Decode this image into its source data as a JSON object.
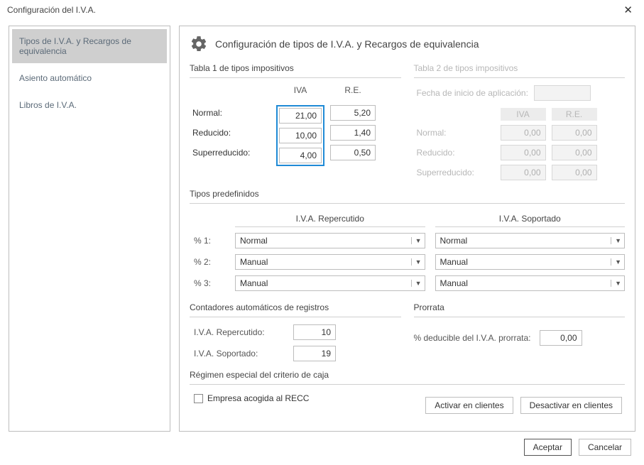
{
  "window": {
    "title": "Configuración del I.V.A."
  },
  "sidebar": {
    "items": [
      {
        "label": "Tipos de I.V.A. y Recargos de equivalencia"
      },
      {
        "label": "Asiento automático"
      },
      {
        "label": "Libros de I.V.A."
      }
    ]
  },
  "header": {
    "title": "Configuración de tipos de I.V.A. y Recargos de equivalencia"
  },
  "table1": {
    "title": "Tabla 1 de tipos impositivos",
    "col_iva": "IVA",
    "col_re": "R.E.",
    "rows": {
      "normal_label": "Normal:",
      "normal_iva": "21,00",
      "normal_re": "5,20",
      "reducido_label": "Reducido:",
      "reducido_iva": "10,00",
      "reducido_re": "1,40",
      "super_label": "Superreducido:",
      "super_iva": "4,00",
      "super_re": "0,50"
    }
  },
  "table2": {
    "title": "Tabla 2 de tipos impositivos",
    "fecha_label": "Fecha de inicio de aplicación:",
    "col_iva": "IVA",
    "col_re": "R.E.",
    "rows": {
      "normal_label": "Normal:",
      "normal_iva": "0,00",
      "normal_re": "0,00",
      "reducido_label": "Reducido:",
      "reducido_iva": "0,00",
      "reducido_re": "0,00",
      "super_label": "Superreducido:",
      "super_iva": "0,00",
      "super_re": "0,00"
    }
  },
  "predef": {
    "title": "Tipos predefinidos",
    "col_rep": "I.V.A. Repercutido",
    "col_sop": "I.V.A. Soportado",
    "row1_label": "% 1:",
    "row2_label": "% 2:",
    "row3_label": "% 3:",
    "rep1": "Normal",
    "rep2": "Manual",
    "rep3": "Manual",
    "sop1": "Normal",
    "sop2": "Manual",
    "sop3": "Manual"
  },
  "counters": {
    "title": "Contadores automáticos de registros",
    "rep_label": "I.V.A. Repercutido:",
    "rep_value": "10",
    "sop_label": "I.V.A. Soportado:",
    "sop_value": "19"
  },
  "prorrata": {
    "title": "Prorrata",
    "label": "% deducible del I.V.A. prorrata:",
    "value": "0,00"
  },
  "recc": {
    "title": "Régimen especial del criterio de caja",
    "checkbox_label": "Empresa acogida al RECC",
    "btn_activate": "Activar en clientes",
    "btn_deactivate": "Desactivar en clientes"
  },
  "footer": {
    "accept": "Aceptar",
    "cancel": "Cancelar"
  }
}
